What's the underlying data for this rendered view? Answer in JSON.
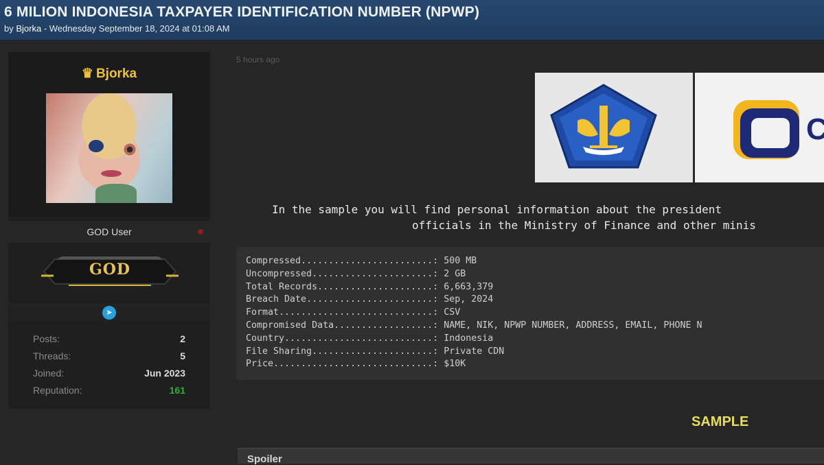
{
  "thread": {
    "title": "6 MILION INDONESIA TAXPAYER IDENTIFICATION NUMBER (NPWP)",
    "byline_prefix": "by ",
    "author": "Bjorka",
    "byline_suffix": " - Wednesday September 18, 2024 at 01:08 AM"
  },
  "user": {
    "crown": "♛",
    "name": "Bjorka",
    "rank": "GOD User",
    "badge": "GOD",
    "stats": [
      {
        "label": "Posts:",
        "value": "2"
      },
      {
        "label": "Threads:",
        "value": "5"
      },
      {
        "label": "Joined:",
        "value": "Jun 2023"
      },
      {
        "label": "Reputation:",
        "value": "161"
      }
    ]
  },
  "post": {
    "time": "5 hours ago",
    "description_line1": "In the sample you will find personal information about the president",
    "description_line2": "officials in the Ministry of Finance and other minis",
    "details": [
      {
        "key": "Compressed",
        "dots": "........................",
        "value": "500 MB"
      },
      {
        "key": "Uncompressed",
        "dots": "......................",
        "value": "2 GB"
      },
      {
        "key": "Total Records",
        "dots": ".....................",
        "value": "6,663,379"
      },
      {
        "key": "Breach Date",
        "dots": ".......................",
        "value": "Sep, 2024"
      },
      {
        "key": "Format",
        "dots": "............................",
        "value": "CSV"
      },
      {
        "key": "Compromised Data",
        "dots": "..................",
        "value": "NAME, NIK, NPWP NUMBER, ADDRESS, EMAIL, PHONE N"
      },
      {
        "key": "Country",
        "dots": "...........................",
        "value": "Indonesia"
      },
      {
        "key": "File Sharing",
        "dots": "......................",
        "value": "Private CDN"
      },
      {
        "key": "Price",
        "dots": ".............................",
        "value": "$10K"
      }
    ],
    "separator": ": ",
    "sample_heading": "SAMPLE",
    "spoiler_label": "Spoiler",
    "banner_right_letter": "C"
  },
  "colors": {
    "header": "#26486f",
    "username": "#f1c232",
    "reputation": "#2fae3d",
    "sample_heading": "#e7df5a",
    "telegram": "#2aa1de"
  },
  "icons": {
    "crown": "crown-icon",
    "telegram": "telegram-icon",
    "online": "status-dot-icon"
  }
}
